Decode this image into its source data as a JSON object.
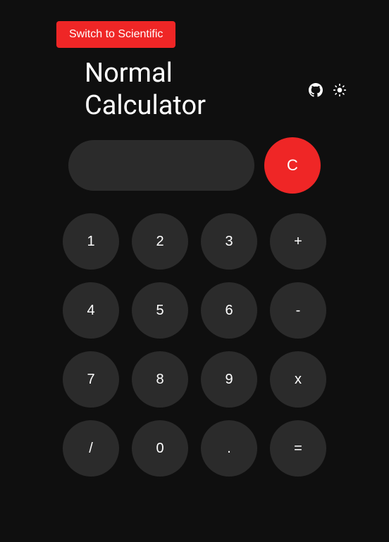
{
  "switch_label": "Switch to Scientific",
  "title": "Normal\nCalculator",
  "display_value": "",
  "clear_label": "C",
  "keys": {
    "r1c1": "1",
    "r1c2": "2",
    "r1c3": "3",
    "r1c4": "+",
    "r2c1": "4",
    "r2c2": "5",
    "r2c3": "6",
    "r2c4": "-",
    "r3c1": "7",
    "r3c2": "8",
    "r3c3": "9",
    "r3c4": "x",
    "r4c1": "/",
    "r4c2": "0",
    "r4c3": ".",
    "r4c4": "="
  },
  "colors": {
    "background": "#0f0f0f",
    "accent": "#ef2626",
    "key": "#2b2b2b"
  },
  "icons": {
    "github": "github-icon",
    "theme": "sun-icon"
  }
}
